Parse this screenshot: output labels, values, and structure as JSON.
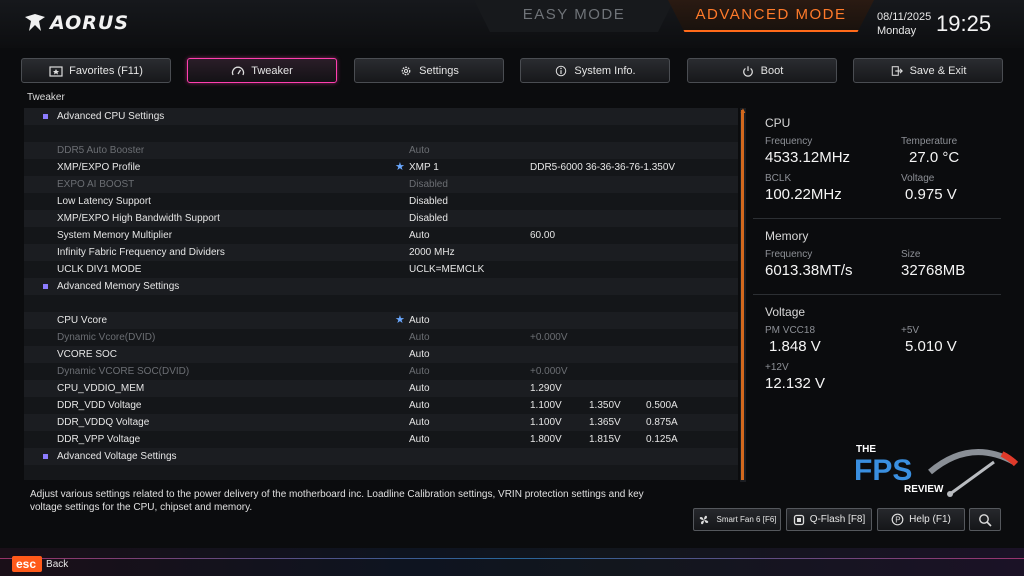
{
  "header": {
    "logo_text": "AORUS",
    "mode_easy": "EASY MODE",
    "mode_advanced": "ADVANCED MODE",
    "date": "08/11/2025",
    "day": "Monday",
    "time": "19:25"
  },
  "tabs": [
    {
      "label": "Favorites (F11)",
      "icon": "favorites-icon"
    },
    {
      "label": "Tweaker",
      "icon": "speedometer-icon",
      "active": true
    },
    {
      "label": "Settings",
      "icon": "gear-icon"
    },
    {
      "label": "System Info.",
      "icon": "info-icon"
    },
    {
      "label": "Boot",
      "icon": "power-icon"
    },
    {
      "label": "Save & Exit",
      "icon": "exit-icon"
    }
  ],
  "section_title": "Tweaker",
  "settings": [
    {
      "label": "Advanced CPU Settings",
      "header": true
    },
    {
      "label": ""
    },
    {
      "label": "DDR5 Auto Booster",
      "v1": "Auto",
      "dim": true
    },
    {
      "label": "XMP/EXPO Profile",
      "star": true,
      "v1": "XMP 1",
      "v2": "DDR5-6000 36-36-36-76-1.350V"
    },
    {
      "label": "EXPO AI BOOST",
      "v1": "Disabled",
      "dim": true
    },
    {
      "label": "Low Latency Support",
      "v1": "Disabled"
    },
    {
      "label": "XMP/EXPO High Bandwidth Support",
      "v1": "Disabled"
    },
    {
      "label": "System Memory Multiplier",
      "v1": "Auto",
      "v2": "60.00"
    },
    {
      "label": "Infinity Fabric Frequency and Dividers",
      "v1": "2000 MHz"
    },
    {
      "label": "UCLK DIV1 MODE",
      "v1": "UCLK=MEMCLK"
    },
    {
      "label": "Advanced Memory Settings",
      "header": true
    },
    {
      "label": ""
    },
    {
      "label": "CPU Vcore",
      "star": true,
      "v1": "Auto"
    },
    {
      "label": "Dynamic Vcore(DVID)",
      "v1": "Auto",
      "v2": "+0.000V",
      "dim": true
    },
    {
      "label": "VCORE SOC",
      "v1": "Auto"
    },
    {
      "label": "Dynamic VCORE SOC(DVID)",
      "v1": "Auto",
      "v2": "+0.000V",
      "dim": true
    },
    {
      "label": "CPU_VDDIO_MEM",
      "v1": "Auto",
      "v2": "1.290V"
    },
    {
      "label": "DDR_VDD Voltage",
      "v1": "Auto",
      "v2": "1.100V",
      "v3": "1.350V",
      "v4": "0.500A"
    },
    {
      "label": "DDR_VDDQ Voltage",
      "v1": "Auto",
      "v2": "1.100V",
      "v3": "1.365V",
      "v4": "0.875A"
    },
    {
      "label": "DDR_VPP Voltage",
      "v1": "Auto",
      "v2": "1.800V",
      "v3": "1.815V",
      "v4": "0.125A"
    },
    {
      "label": "Advanced Voltage Settings",
      "header": true
    }
  ],
  "panel": {
    "cpu_title": "CPU",
    "freq_label": "Frequency",
    "cpu_freq": "4533.12MHz",
    "temp_label": "Temperature",
    "cpu_temp": "27.0 °C",
    "bclk_label": "BCLK",
    "bclk": "100.22MHz",
    "volt_label": "Voltage",
    "cpu_volt": "0.975 V",
    "mem_title": "Memory",
    "mem_freq_label": "Frequency",
    "mem_freq": "6013.38MT/s",
    "size_label": "Size",
    "mem_size": "32768MB",
    "voltage_title": "Voltage",
    "pm_label": "PM VCC18",
    "pm_value": "1.848 V",
    "v5_label": "+5V",
    "v5_value": "5.010 V",
    "v12_label": "+12V",
    "v12_value": "12.132 V"
  },
  "description": "Adjust various settings related to the power delivery of the motherboard inc. Loadline Calibration settings, VRIN protection settings and key voltage settings for the CPU, chipset and memory.",
  "bottom_buttons": {
    "smartfan": "Smart Fan 6 [F6]",
    "qflash": "Q-Flash [F8]",
    "help": "Help (F1)"
  },
  "watermark": {
    "line1": "THE",
    "line2": "FPS",
    "line3": "REVIEW"
  },
  "footer": {
    "esc": "esc",
    "back": "Back"
  },
  "colors": {
    "accent_orange": "#ff6a1a",
    "accent_pink": "#ff3fb0",
    "star_blue": "#6aa8ff"
  }
}
